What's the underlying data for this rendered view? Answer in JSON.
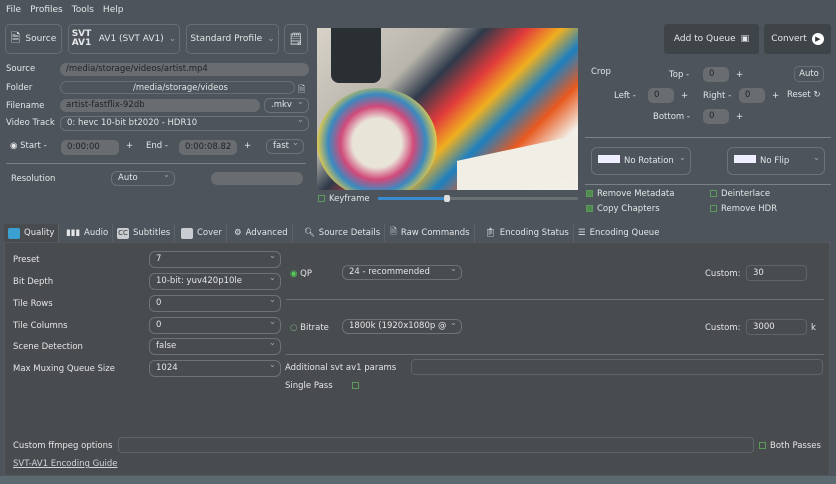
{
  "menu": [
    "File",
    "Profiles",
    "Tools",
    "Help"
  ],
  "toolbar": {
    "source": "Source",
    "encoder": "AV1 (SVT AV1)",
    "encoder_logo": "SVT AV1",
    "profile": "Standard Profile",
    "add_queue": "Add to Queue",
    "convert": "Convert"
  },
  "fields": {
    "source_label": "Source",
    "source": "/media/storage/videos/artist.mp4",
    "folder_label": "Folder",
    "folder": "/media/storage/videos",
    "filename_label": "Filename",
    "filename": "artist-fastflix-92db",
    "ext": ".mkv",
    "track_label": "Video Track",
    "track": "0: hevc 10-bit bt2020 - HDR10",
    "start_label": "Start",
    "start": "0:00:00",
    "end_label": "End",
    "end": "0:00:08.82",
    "seek": "fast",
    "resolution_label": "Resolution",
    "resolution": "Auto",
    "minus": "-",
    "plus": "+"
  },
  "preview": {
    "keyframe": "Keyframe",
    "slider_value": 0.35
  },
  "crop": {
    "label": "Crop",
    "top_label": "Top",
    "top": "0",
    "left_label": "Left",
    "left": "0",
    "right_label": "Right",
    "right": "0",
    "bottom_label": "Bottom",
    "bottom": "0",
    "auto": "Auto",
    "reset": "Reset"
  },
  "transform": {
    "rotation": "No Rotation",
    "flip": "No Flip"
  },
  "options": [
    {
      "label": "Remove Metadata",
      "checked": true
    },
    {
      "label": "Deinterlace",
      "checked": false
    },
    {
      "label": "Copy Chapters",
      "checked": true
    },
    {
      "label": "Remove HDR",
      "checked": false
    }
  ],
  "tabs": [
    "Quality",
    "Audio",
    "Subtitles",
    "Cover",
    "Advanced",
    "Source Details",
    "Raw Commands",
    "Encoding Status",
    "Encoding Queue"
  ],
  "quality": {
    "rows": [
      {
        "label": "Preset",
        "value": "7"
      },
      {
        "label": "Bit Depth",
        "value": "10-bit: yuv420p10le"
      },
      {
        "label": "Tile Rows",
        "value": "0"
      },
      {
        "label": "Tile Columns",
        "value": "0"
      },
      {
        "label": "Scene Detection",
        "value": "false"
      },
      {
        "label": "Max Muxing Queue Size",
        "value": "1024"
      }
    ],
    "qp_label": "QP",
    "qp": "24 - recommended",
    "custom_label": "Custom:",
    "qp_custom": "30",
    "bitrate_label": "Bitrate",
    "bitrate": "1800k (1920x1080p @",
    "bitrate_custom": "3000",
    "k": "k",
    "additional_label": "Additional svt av1 params",
    "single_pass": "Single Pass",
    "ffmpeg_label": "Custom ffmpeg options",
    "both_passes": "Both Passes",
    "guide": "SVT-AV1 Encoding Guide"
  }
}
